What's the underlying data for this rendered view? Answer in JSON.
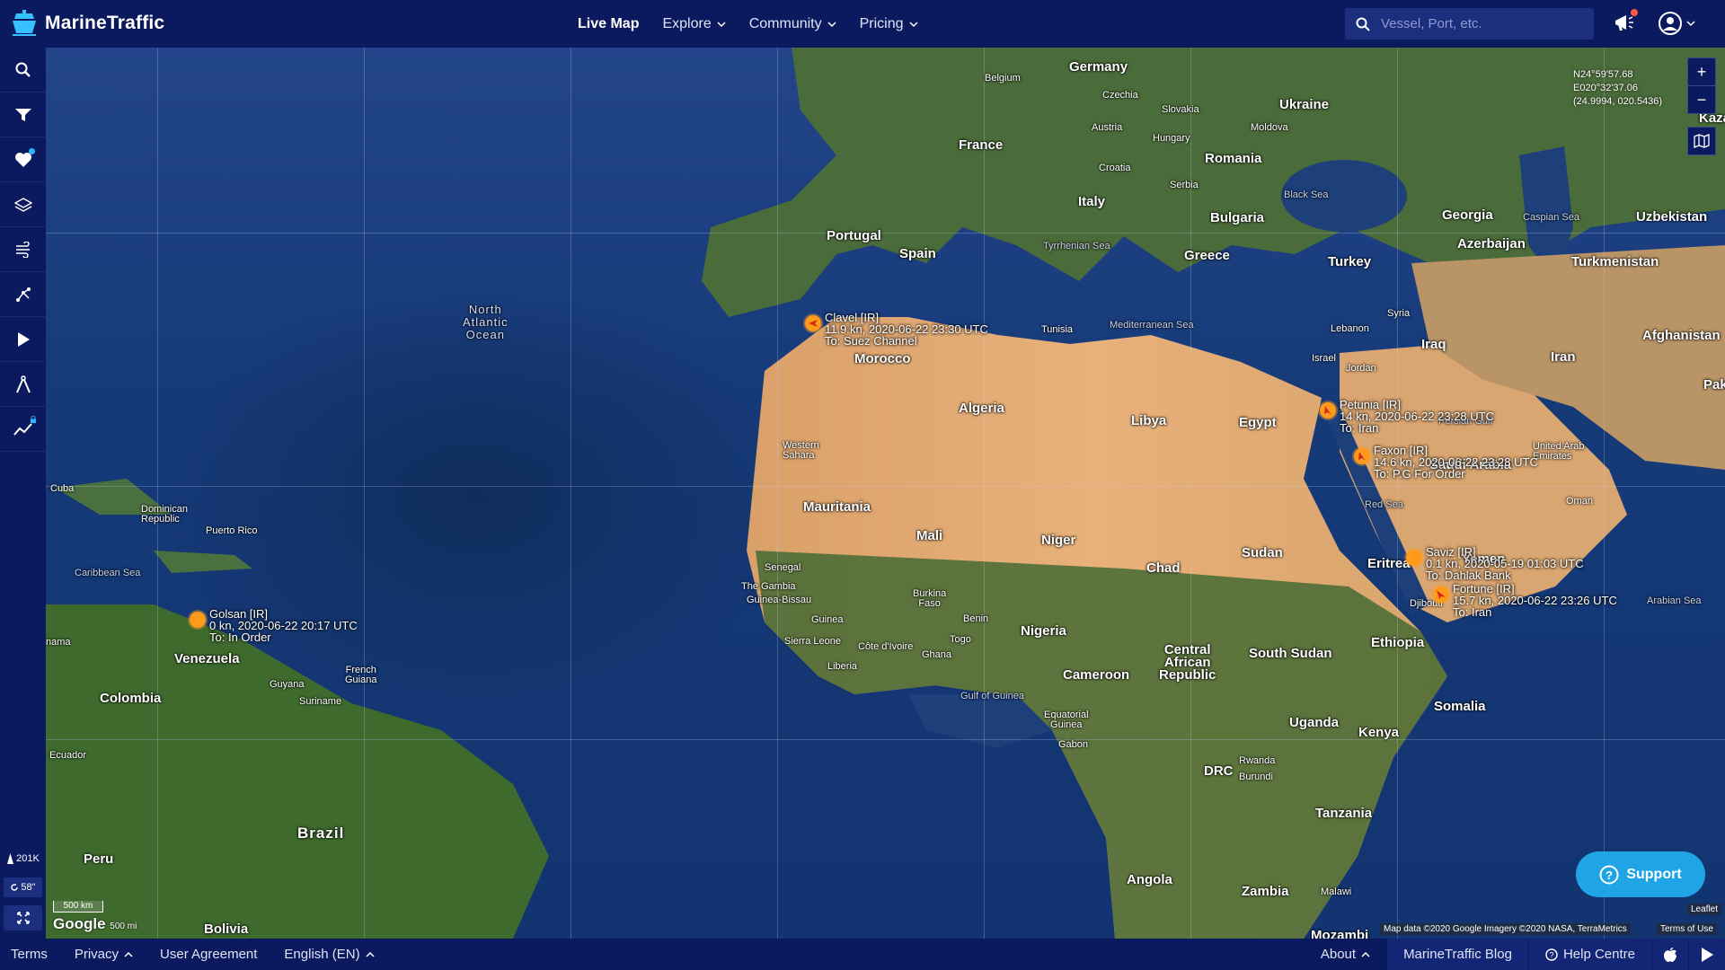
{
  "header": {
    "logo_text": "MarineTraffic",
    "nav": [
      {
        "label": "Live Map",
        "active": true
      },
      {
        "label": "Explore"
      },
      {
        "label": "Community"
      },
      {
        "label": "Pricing"
      }
    ],
    "search_placeholder": "Vessel, Port, etc."
  },
  "sidebar": {
    "buttons": [
      "search-icon",
      "filter-icon",
      "heart-icon",
      "layers-icon",
      "wind-icon",
      "route-icon",
      "play-icon",
      "compass-icon",
      "chart-icon"
    ],
    "vessel_count": "201K",
    "refresh_seconds": "58\""
  },
  "map": {
    "coords": {
      "lat": "N24°59'57.68",
      "lon": "E020°32'37.06",
      "decimal": "(24.9994, 020.5436)"
    },
    "zoom_in": "+",
    "zoom_out": "−",
    "scale": "500 km",
    "scale_alt": "500 mi",
    "google": "Google",
    "attribution": "Map data ©2020 Google Imagery ©2020 NASA, TerraMetrics",
    "terms": "Terms of Use",
    "leaflet": "Leaflet",
    "labels": {
      "germany": "Germany",
      "belgium": "Belgium",
      "czechia": "Czechia",
      "slovakia": "Slovakia",
      "ukraine": "Ukraine",
      "austria": "Austria",
      "hungary": "Hungary",
      "moldova": "Moldova",
      "france": "France",
      "romania": "Romania",
      "croatia": "Croatia",
      "serbia": "Serbia",
      "italy": "Italy",
      "bulgaria": "Bulgaria",
      "black_sea": "Black Sea",
      "georgia": "Georgia",
      "caspian": "Caspian Sea",
      "uzbekistan": "Uzbekistan",
      "kazakhs": "Kazakhs",
      "portugal": "Portugal",
      "spain": "Spain",
      "tyrrhenian": "Tyrrhenian Sea",
      "greece": "Greece",
      "turkey": "Turkey",
      "azerbaijan": "Azerbaijan",
      "turkmenistan": "Turkmenistan",
      "tunisia": "Tunisia",
      "mediterranean": "Mediterranean Sea",
      "lebanon": "Lebanon",
      "syria": "Syria",
      "afghanistan": "Afghanistan",
      "iraq": "Iraq",
      "israel": "Israel",
      "jordan": "Jordan",
      "iran": "Iran",
      "pak": "Pak",
      "morocco": "Morocco",
      "algeria": "Algeria",
      "libya": "Libya",
      "egypt": "Egypt",
      "persian_gulf": "Persian Gulf",
      "western_sahara": "Western\nSahara",
      "saudi_arabia": "Saudi Arabia",
      "uae": "United Arab\nEmirates",
      "red_sea": "Red Sea",
      "oman": "Oman",
      "mauritania": "Mauritania",
      "mali": "Mali",
      "niger": "Niger",
      "chad": "Chad",
      "sudan": "Sudan",
      "eritrea": "Eritrea",
      "yemen": "Yemen",
      "arabian_sea": "Arabian Sea",
      "senegal": "Senegal",
      "gambia": "The Gambia",
      "guinea_bissau": "Guinea-Bissau",
      "guinea": "Guinea",
      "burkina": "Burkina\nFaso",
      "benin": "Benin",
      "nigeria": "Nigeria",
      "sierra_leone": "Sierra Leone",
      "cote_divoire": "Côte d'Ivoire",
      "togo": "Togo",
      "ghana": "Ghana",
      "liberia": "Liberia",
      "djibouti": "Djibouti",
      "ethiopia": "Ethiopia",
      "car": "Central\nAfrican\nRepublic",
      "south_sudan": "South Sudan",
      "cameroon": "Cameroon",
      "gulf_guinea": "Gulf of Guinea",
      "eq_guinea": "Equatorial\nGuinea",
      "gabon": "Gabon",
      "somalia": "Somalia",
      "uganda": "Uganda",
      "kenya": "Kenya",
      "drc": "DRC",
      "rwanda": "Rwanda",
      "burundi": "Burundi",
      "tanzania": "Tanzania",
      "angola": "Angola",
      "zambia": "Zambia",
      "malawi": "Malawi",
      "mozambi": "Mozambi",
      "north_atlantic": "North\nAtlantic\nOcean",
      "cuba": "Cuba",
      "dominican": "Dominican\nRepublic",
      "puerto_rico": "Puerto Rico",
      "caribbean": "Caribbean Sea",
      "panama": "nama",
      "venezuela": "Venezuela",
      "guyana": "Guyana",
      "french_guiana": "French\nGuiana",
      "suriname": "Suriname",
      "colombia": "Colombia",
      "ecuador": "Ecuador",
      "brazil": "Brazil",
      "peru": "Peru",
      "bolivia": "Bolivia"
    },
    "vessels": [
      {
        "name": "Clavel [IR]",
        "line2": "11.9 kn, 2020-06-22 23:30 UTC",
        "line3": "To: Suez Channel"
      },
      {
        "name": "Petunia [IR]",
        "line2": "14 kn, 2020-06-22 23:28 UTC",
        "line3": "To: Iran"
      },
      {
        "name": "Faxon [IR]",
        "line2": "14.6 kn, 2020-06-22 23:28 UTC",
        "line3": "To: P.G For Order"
      },
      {
        "name": "Saviz [IR]",
        "line2": "0.1 kn, 2020-05-19 01:03 UTC",
        "line3": "To: Dahlak Bank"
      },
      {
        "name": "Fortune [IR]",
        "line2": "15.7 kn, 2020-06-22 23:26 UTC",
        "line3": "To: Iran"
      },
      {
        "name": "Golsan [IR]",
        "line2": "0 kn, 2020-06-22 20:17 UTC",
        "line3": "To: In Order"
      }
    ],
    "support_label": "Support"
  },
  "footer": {
    "left": [
      "Terms",
      "Privacy",
      "User Agreement",
      "English (EN)"
    ],
    "about": "About",
    "blog": "MarineTraffic Blog",
    "help": "Help Centre"
  },
  "colors": {
    "navy": "#0b1a5e",
    "vessel_orange": "#ff9a1a",
    "support_blue": "#1fa4e6"
  }
}
